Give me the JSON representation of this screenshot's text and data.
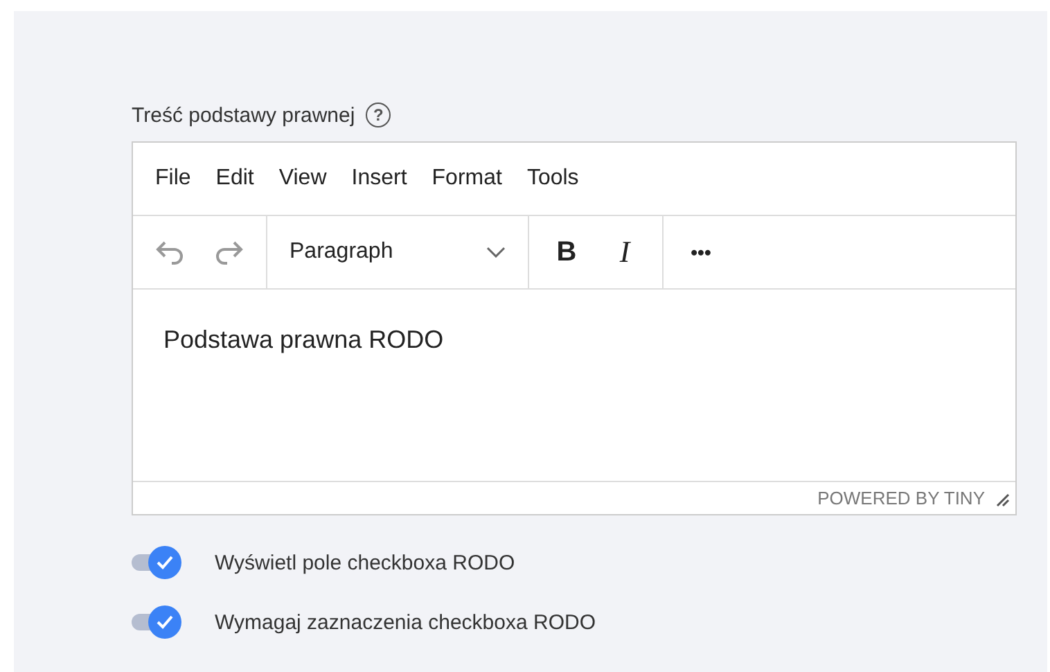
{
  "field": {
    "label": "Treść podstawy prawnej",
    "help_icon": "?"
  },
  "editor": {
    "menu": [
      "File",
      "Edit",
      "View",
      "Insert",
      "Format",
      "Tools"
    ],
    "block_format": "Paragraph",
    "bold": "B",
    "italic": "I",
    "more": "•••",
    "content": "Podstawa prawna RODO",
    "branding": "POWERED BY TINY"
  },
  "toggles": [
    {
      "label": "Wyświetl pole checkboxa RODO",
      "on": true
    },
    {
      "label": "Wymagaj zaznaczenia checkboxa RODO",
      "on": true
    }
  ]
}
